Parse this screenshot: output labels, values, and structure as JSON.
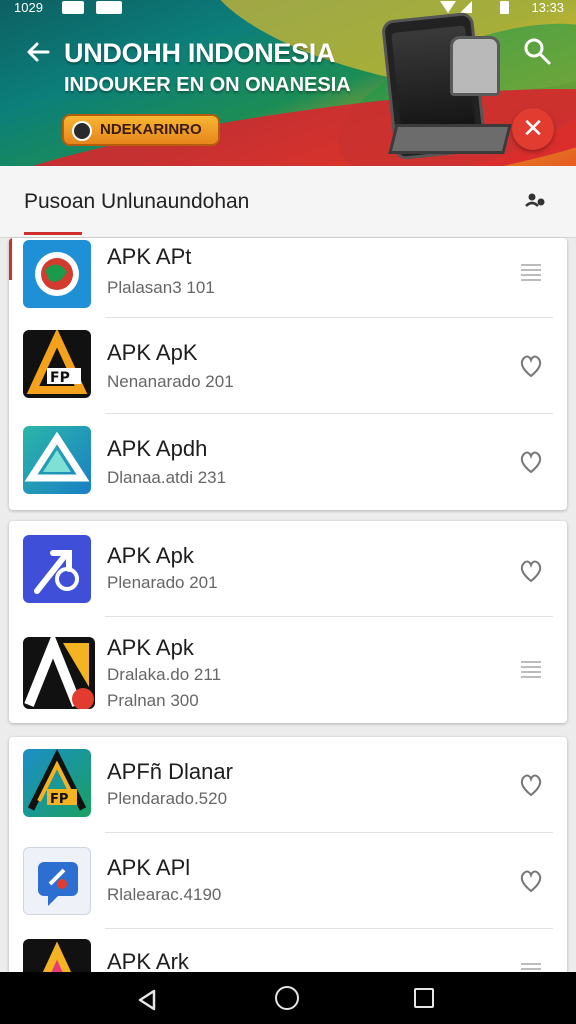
{
  "status_bar": {
    "time_left": "1029",
    "time_right": "13:33"
  },
  "header": {
    "title": "UNDOHH INDONESIA",
    "subtitle": "INDOUKER EN ON ONANESIA",
    "promo_label": "NDEKARINRO",
    "close_glyph": "✕",
    "colors": {
      "accent_red": "#e23b2f",
      "teal": "#0c7f7a",
      "gold": "#f0c02a"
    }
  },
  "subheader": {
    "label": "Pusoan Unlunaundohan"
  },
  "apps": [
    {
      "name": "APK APt",
      "meta": "Plalasan3 101",
      "action": "list-icon",
      "icon": "apk-globe-icon"
    },
    {
      "name": "APK ApK",
      "meta": "Nenanarado 201",
      "action": "heart-icon",
      "icon": "apk-letter-a-icon"
    },
    {
      "name": "APK Apdh",
      "meta": "Dlanaa.atdi 231",
      "action": "heart-icon",
      "icon": "apk-triangle-icon"
    },
    {
      "name": "APK Apk",
      "meta": "Plenarado 201",
      "action": "heart-icon",
      "icon": "apk-arrow-icon"
    },
    {
      "name": "APK Apk",
      "meta": "Dralaka.do 211",
      "meta2": "Pralnan 300",
      "action": "list-icon",
      "icon": "apk-letter-a-badge-icon"
    },
    {
      "name": "APFñ Dlanar",
      "meta": "Plendarado.520",
      "action": "heart-icon",
      "icon": "apk-fp-icon"
    },
    {
      "name": "APK APl",
      "meta": "Rlalearac.4190",
      "action": "heart-icon",
      "icon": "apk-chat-icon"
    },
    {
      "name": "APK Ark",
      "meta": "",
      "action": "list-icon",
      "icon": "apk-letter-a-color-icon"
    }
  ]
}
